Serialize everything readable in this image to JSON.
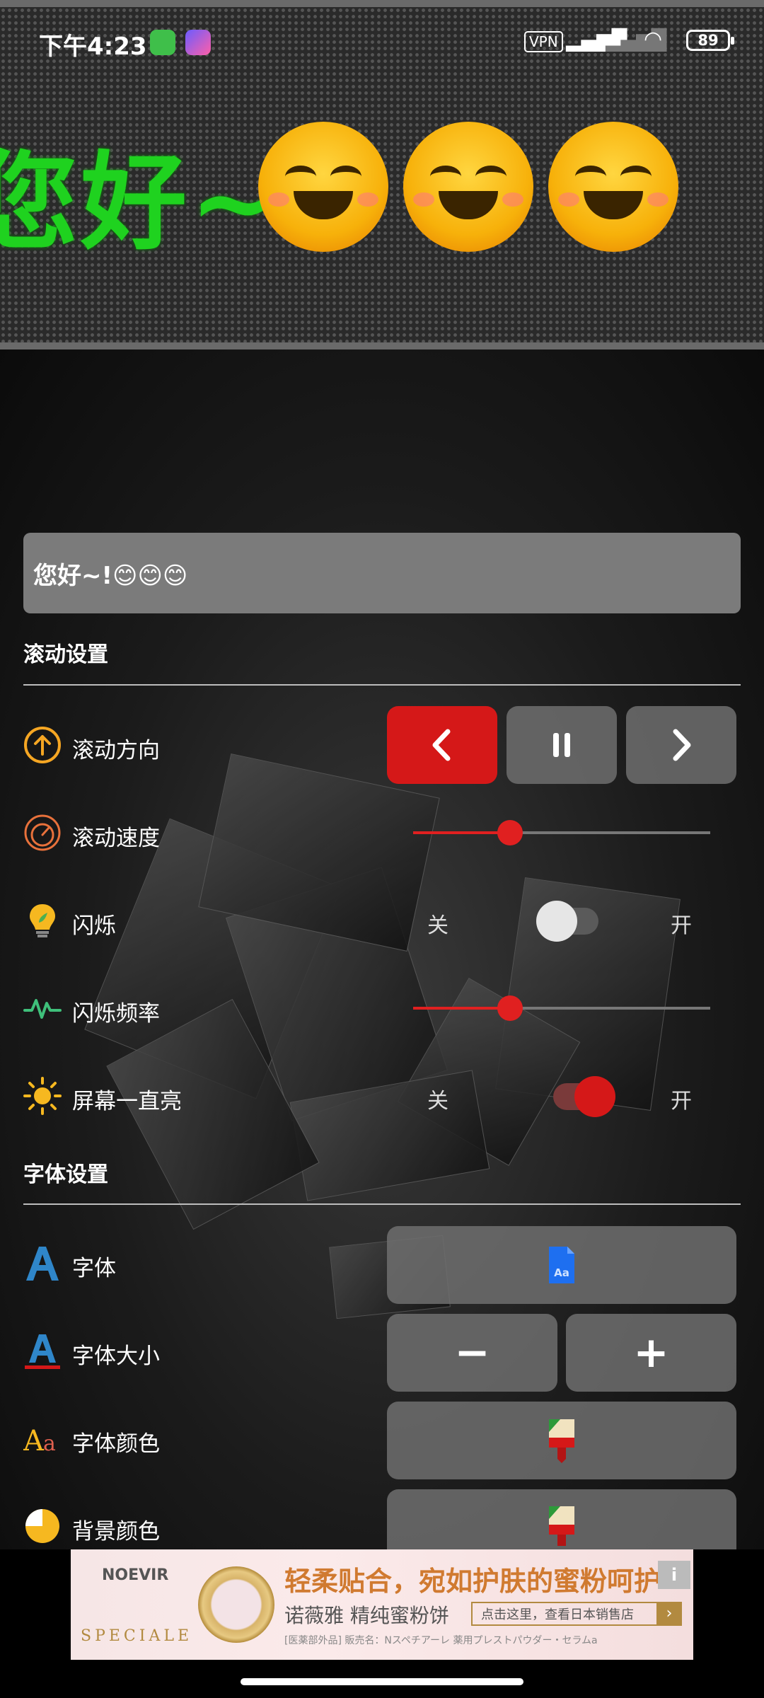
{
  "status_bar": {
    "time": "下午4:23",
    "vpn": "VPN",
    "battery": "89",
    "icons": [
      "app-icon-green",
      "app-icon-rocket",
      "vpn-icon",
      "signal-icon",
      "signal-weak-icon",
      "wifi-icon",
      "battery-icon"
    ]
  },
  "led_display": {
    "text": "您好~!",
    "emoji_count": 3,
    "text_color": "#1fd21f",
    "background": "#2a2a2a"
  },
  "input": {
    "value": "您好~!😊😊😊"
  },
  "scroll_section": {
    "title": "滚动设置",
    "direction": {
      "label": "滚动方向",
      "buttons": [
        "<",
        "II",
        ">"
      ],
      "selected": "<"
    },
    "speed": {
      "label": "滚动速度",
      "value": 0.325
    },
    "blink": {
      "label": "闪烁",
      "off_label": "关",
      "on_label": "开",
      "on": false
    },
    "blink_rate": {
      "label": "闪烁频率",
      "value": 0.325
    },
    "screen_on": {
      "label": "屏幕一直亮",
      "off_label": "关",
      "on_label": "开",
      "on": true
    }
  },
  "font_section": {
    "title": "字体设置",
    "font": {
      "label": "字体"
    },
    "font_size": {
      "label": "字体大小",
      "minus": "−",
      "plus": "+"
    },
    "font_color": {
      "label": "字体颜色"
    },
    "bg_color": {
      "label": "背景颜色"
    }
  },
  "ad": {
    "brand": "NOEVIR",
    "brand_sub": "SPECIALE",
    "headline": "轻柔贴合，宛如护肤的蜜粉呵护",
    "sub": "诺薇雅 精纯蜜粉饼",
    "cta": "点击这里，查看日本销售店",
    "cta_arrow": "›",
    "small": "[医薬部外品] 販売名：Nスペチアーレ 薬用プレストパウダー・セラムa",
    "info": "i"
  },
  "colors": {
    "accent": "#d51818",
    "slider_track": "#777777",
    "button_bg": "#6e6e6e",
    "input_bg": "#7b7b7b"
  }
}
